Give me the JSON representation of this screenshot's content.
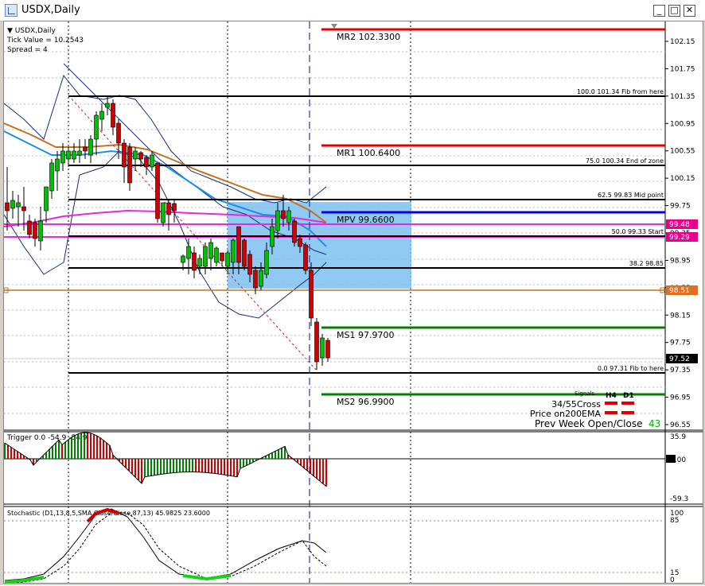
{
  "window": {
    "title": "USDX,Daily",
    "btn_minimize": "_",
    "btn_maximize": "□",
    "btn_close": "✕"
  },
  "info": {
    "symbol": "USDX,Daily",
    "tick_value": "Tick Value = 10.2543",
    "spread": "Spread = 4"
  },
  "price_axis": {
    "ticks": [
      "102.15",
      "101.75",
      "101.35",
      "100.95",
      "100.55",
      "100.15",
      "99.75",
      "99.35",
      "98.95",
      "98.55",
      "98.15",
      "97.75",
      "97.35",
      "96.95",
      "96.55"
    ]
  },
  "price_tags": [
    {
      "label": "99.48",
      "color": "#e5008c"
    },
    {
      "label": "99.29",
      "color": "#e5008c"
    },
    {
      "label": "98.51",
      "color": "#e0701e"
    },
    {
      "label": "97.52",
      "color": "#000000"
    }
  ],
  "pivot_levels": [
    {
      "name": "MR2",
      "value": "102.3300",
      "color": "#e00000"
    },
    {
      "name": "MR1",
      "value": "100.6400",
      "color": "#e00000"
    },
    {
      "name": "MPV",
      "value": "99.6600",
      "color": "#0000e0"
    },
    {
      "name": "MS1",
      "value": "97.9700",
      "color": "#008000"
    },
    {
      "name": "MS2",
      "value": "96.9900",
      "color": "#008000"
    }
  ],
  "fib_levels": [
    {
      "pct": "100.0",
      "price": "101.34",
      "note": "Fib from here"
    },
    {
      "pct": "75.0",
      "price": "100.34",
      "note": "End of zone"
    },
    {
      "pct": "62.5",
      "price": "99.83",
      "note": "Mid point"
    },
    {
      "pct": "50.0",
      "price": "99.33",
      "note": "Start"
    },
    {
      "pct": "38.2",
      "price": "98.85",
      "note": ""
    },
    {
      "pct": "0.0",
      "price": "97.31",
      "note": "Fib to here"
    }
  ],
  "signals": {
    "header": "Signals",
    "col_h4": "H4",
    "col_d1": "D1",
    "row1": "34/55Cross",
    "row2": "Price on200EMA",
    "row3": "Prev Week Open/Close",
    "count": "43",
    "color_h4": "#e00000",
    "color_d1": "#e00000"
  },
  "trigger": {
    "label": "Trigger 0.0 -54.9 -54.9",
    "ticks": [
      "35.9",
      "0.00",
      "-59.3"
    ]
  },
  "stochastic": {
    "label": "Stochastic (D1,13,8,5,SMA,Close/Close,87,13) 45.9825 23.6000",
    "ticks": [
      "100",
      "85",
      "15",
      "0"
    ]
  },
  "colors": {
    "up_candle": "#00c000",
    "down_candle": "#d00000",
    "zone": "#7dc1f0",
    "ema200": "#c8701e",
    "ema_blue": "#1e8fe6",
    "ema_magenta": "#e52ad6"
  }
}
